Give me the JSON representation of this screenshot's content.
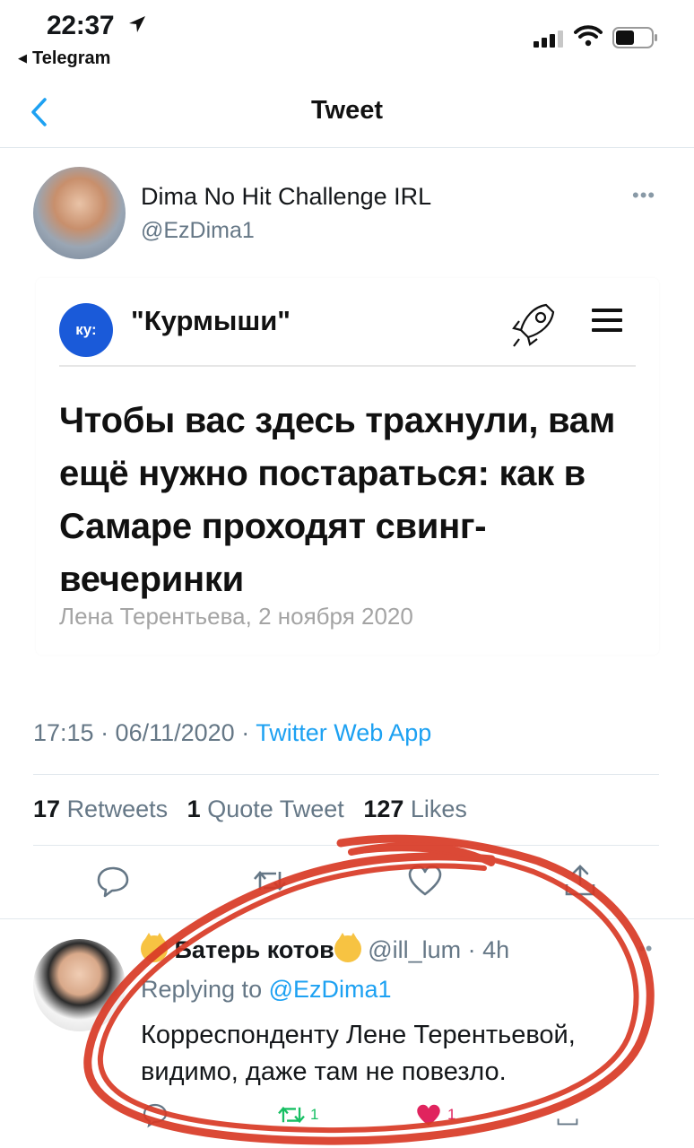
{
  "status_bar": {
    "time": "22:37",
    "back_app": "Telegram"
  },
  "nav": {
    "title": "Tweet"
  },
  "tweet": {
    "author_name": "Dima No Hit Challenge IRL",
    "author_handle": "@EzDima1",
    "card": {
      "site_badge": "ку:",
      "site_name": "\"Курмыши\"",
      "headline": "Чтобы вас здесь трахнули, вам ещё нужно постараться: как в Самаре проходят свинг-вечеринки",
      "byline": "Лена Терентьева, 2 ноября 2020"
    },
    "meta_time": "17:15 · 06/11/2020 · ",
    "meta_source": "Twitter Web App",
    "stats": {
      "retweets_count": "17",
      "retweets_label": "Retweets",
      "quotes_count": "1",
      "quotes_label": "Quote Tweet",
      "likes_count": "127",
      "likes_label": "Likes"
    }
  },
  "reply": {
    "name": "Батерь котов",
    "handle_time": "@ill_lum · 4h",
    "replying_label": "Replying to ",
    "replying_mention": "@EzDima1",
    "text": "Корреспонденту Лене Терентьевой, видимо, даже там не повезло.",
    "retweet_count": "1",
    "like_count": "1"
  },
  "colors": {
    "accent": "#1da1f2",
    "muted": "#657786",
    "retweet_green": "#17bf63",
    "like_red": "#e0245e",
    "scribble_red": "#d93a26"
  }
}
